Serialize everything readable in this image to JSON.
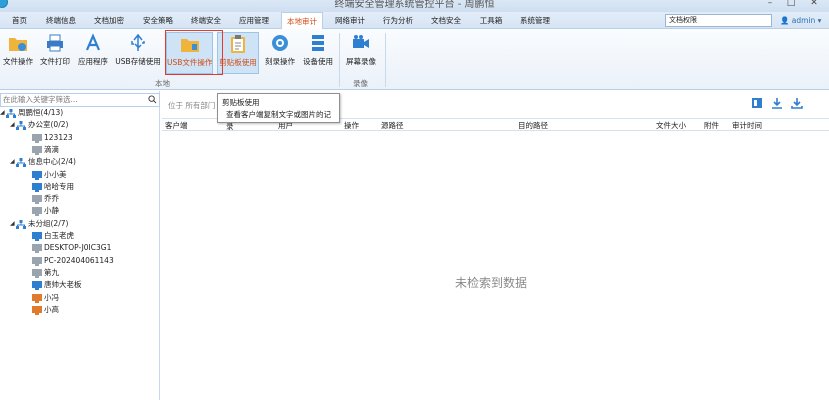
{
  "window": {
    "title": "终端安全管理系统管控平台 - 周鹏恒"
  },
  "menu": [
    "首页",
    "终端信息",
    "文档加密",
    "安全策略",
    "终端安全",
    "应用管理",
    "本地审计",
    "网络审计",
    "行为分析",
    "文档安全",
    "工具箱",
    "系统管理"
  ],
  "menu_active": "本地审计",
  "search": {
    "value": "文档权限"
  },
  "user": {
    "name": "admin"
  },
  "ribbon": {
    "groups": [
      {
        "label": "本地",
        "buttons": [
          "文件操作",
          "文件打印",
          "应用程序",
          "USB存储使用",
          "USB文件操作",
          "剪贴板使用",
          "刻录操作",
          "设备使用"
        ]
      },
      {
        "label": "录像",
        "buttons": [
          "屏幕录像"
        ]
      }
    ],
    "selected": "剪贴板使用"
  },
  "tree": {
    "search_placeholder": "在此输入关键字筛选...",
    "nodes": [
      {
        "label": "周鹏恒(4/13)",
        "level": 0,
        "type": "root"
      },
      {
        "label": "办公室(0/2)",
        "level": 1,
        "type": "group"
      },
      {
        "label": "123123",
        "level": 2,
        "type": "offline"
      },
      {
        "label": "滴滴",
        "level": 2,
        "type": "offline"
      },
      {
        "label": "信息中心(2/4)",
        "level": 1,
        "type": "group"
      },
      {
        "label": "小小美",
        "level": 2,
        "type": "online"
      },
      {
        "label": "哈哈专用",
        "level": 2,
        "type": "online"
      },
      {
        "label": "乔乔",
        "level": 2,
        "type": "offline"
      },
      {
        "label": "小静",
        "level": 2,
        "type": "offline"
      },
      {
        "label": "未分组(2/7)",
        "level": 1,
        "type": "group"
      },
      {
        "label": "白玉老虎",
        "level": 2,
        "type": "online"
      },
      {
        "label": "DESKTOP-J0IC3G1",
        "level": 2,
        "type": "offline"
      },
      {
        "label": "PC-202404061143",
        "level": 2,
        "type": "offline"
      },
      {
        "label": "第九",
        "level": 2,
        "type": "offline"
      },
      {
        "label": "唐帅大老板",
        "level": 2,
        "type": "online"
      },
      {
        "label": "小冯",
        "level": 2,
        "type": "locked"
      },
      {
        "label": "小高",
        "level": 2,
        "type": "locked"
      }
    ]
  },
  "breadcrumb": "位于 所有部门",
  "table": {
    "columns": [
      "客户端",
      "用户",
      "操作",
      "源路径",
      "目的路径",
      "文件大小",
      "附件",
      "审计时间"
    ],
    "empty_text": "未检索到数据"
  },
  "tooltip": {
    "title": "剪贴板使用",
    "text": "查看客户端复制文字或图片的记录"
  }
}
